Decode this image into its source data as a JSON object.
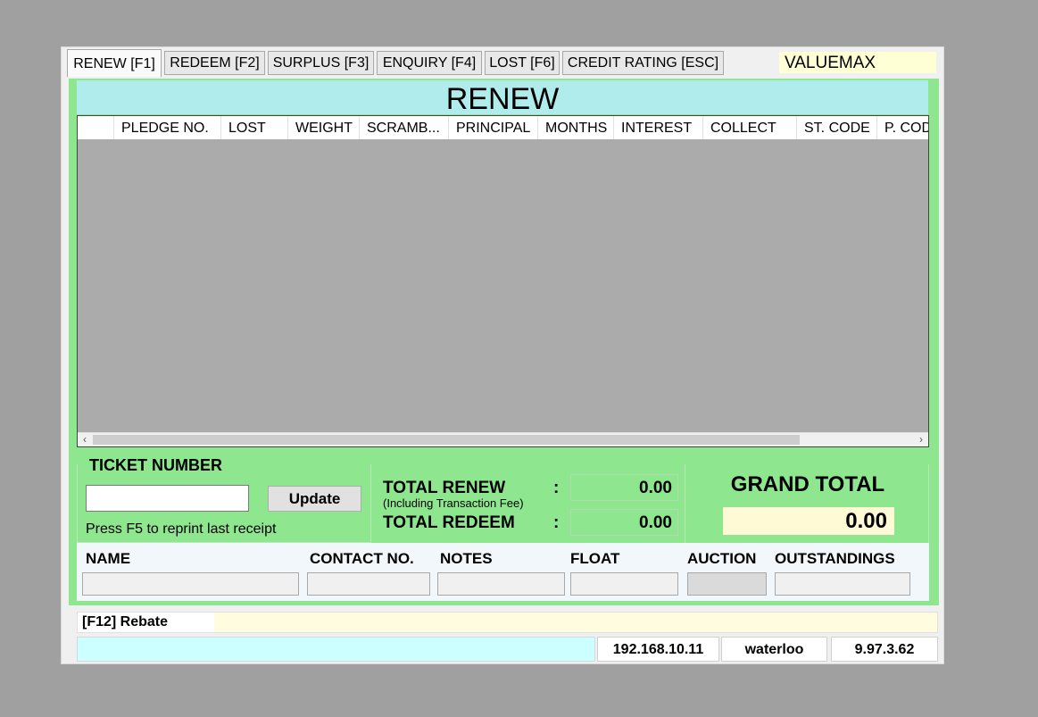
{
  "tabs": [
    {
      "label": "RENEW  [F1]",
      "active": true
    },
    {
      "label": "REDEEM [F2]",
      "active": false
    },
    {
      "label": "SURPLUS [F3]",
      "active": false
    },
    {
      "label": "ENQUIRY [F4]",
      "active": false
    },
    {
      "label": "LOST [F6]",
      "active": false
    },
    {
      "label": "CREDIT RATING [ESC]",
      "active": false
    }
  ],
  "company": "VALUEMAX",
  "main": {
    "title": "RENEW",
    "columns": [
      "",
      "PLEDGE NO.",
      "LOST",
      "WEIGHT",
      "SCRAMB...",
      "PRINCIPAL",
      "MONTHS",
      "INTEREST",
      "COLLECT",
      "ST. CODE",
      "P. COD"
    ],
    "rows": []
  },
  "scrollbar": {
    "left_icon": "chevron-left-icon",
    "right_icon": "chevron-right-icon",
    "left_glyph": "‹",
    "right_glyph": "›"
  },
  "ticket": {
    "title": "TICKET NUMBER",
    "value": "",
    "update_label": "Update",
    "hint": "Press F5 to reprint last receipt"
  },
  "totals": {
    "renew_label": "TOTAL RENEW",
    "renew_sub": "(Including Transaction Fee)",
    "renew_value": "0.00",
    "redeem_label": "TOTAL REDEEM",
    "redeem_value": "0.00",
    "colon": ":"
  },
  "grand_total": {
    "label": "GRAND TOTAL",
    "value": "0.00"
  },
  "customer": {
    "name_label": "NAME",
    "contact_label": "CONTACT NO.",
    "notes_label": "NOTES",
    "float_label": "FLOAT",
    "auction_label": "AUCTION",
    "outstandings_label": "OUTSTANDINGS"
  },
  "rebate": {
    "label": "[F12] Rebate",
    "value": ""
  },
  "status": {
    "message": "",
    "ip": "192.168.10.11",
    "branch": "waterloo",
    "version": "9.97.3.62"
  },
  "colors": {
    "panel_green": "#8ee68e",
    "title_cyan": "#b0ecec",
    "grand_yellow": "#fffad6",
    "status_cyan": "#ccffff"
  }
}
